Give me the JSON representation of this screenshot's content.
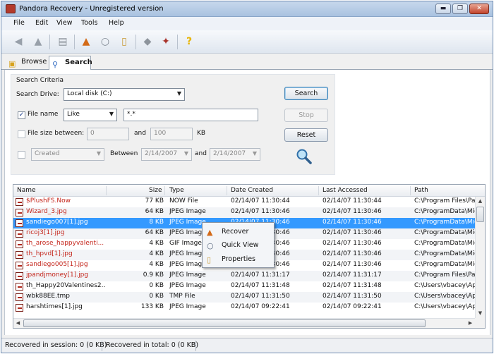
{
  "window": {
    "title": "Pandora Recovery - Unregistered version"
  },
  "menu": [
    "File",
    "Edit",
    "View",
    "Tools",
    "Help"
  ],
  "toolbar_icons": [
    "back-arrow-icon",
    "forward-arrow-icon",
    "drive-icon",
    "recover-icon",
    "quick-view-icon",
    "properties-icon",
    "eraser-icon",
    "wand-icon",
    "help-icon"
  ],
  "tabs": [
    {
      "label": "Browse",
      "icon": "folder-icon",
      "active": false
    },
    {
      "label": "Search",
      "icon": "magnifier-icon",
      "active": true
    }
  ],
  "criteria": {
    "legend": "Search Criteria",
    "drive_label": "Search Drive:",
    "drive_value": "Local disk (C:)",
    "filename_label": "File name",
    "filename_checked": true,
    "filename_mode": "Like",
    "filename_pattern": "*.*",
    "filesize_label": "File size between:",
    "filesize_min": "0",
    "filesize_and": "and",
    "filesize_max": "100",
    "filesize_unit": "KB",
    "date_type": "Created",
    "date_between": "Between",
    "date_from": "2/14/2007",
    "date_and": "and",
    "date_to": "2/14/2007"
  },
  "buttons": {
    "search": "Search",
    "stop": "Stop",
    "reset": "Reset"
  },
  "columns": {
    "name": "Name",
    "size": "Size",
    "type": "Type",
    "created": "Date Created",
    "accessed": "Last Accessed",
    "path": "Path"
  },
  "rows": [
    {
      "name": "$PlushFS.Now",
      "size": "77 KB",
      "type": "NOW File",
      "created": "02/14/07 11:30:44",
      "accessed": "02/14/07 11:30:44",
      "path": "C:\\Program Files\\Par",
      "red": true
    },
    {
      "name": "Wizard_3.jpg",
      "size": "64 KB",
      "type": "JPEG Image",
      "created": "02/14/07 11:30:46",
      "accessed": "02/14/07 11:30:46",
      "path": "C:\\ProgramData\\Mic",
      "red": true
    },
    {
      "name": "sandiego007[1].jpg",
      "size": "8 KB",
      "type": "JPEG Image",
      "created": "02/14/07 11:30:46",
      "accessed": "02/14/07 11:30:46",
      "path": "C:\\ProgramData\\Mic",
      "red": true,
      "selected": true
    },
    {
      "name": "ricoj3[1].jpg",
      "size": "64 KB",
      "type": "JPEG Image",
      "created": "02/14/07 11:30:46",
      "accessed": "02/14/07 11:30:46",
      "path": "C:\\ProgramData\\Mic",
      "red": true
    },
    {
      "name": "th_arose_happyvalenti...",
      "size": "4 KB",
      "type": "GIF Image",
      "created": "02/14/07 11:30:46",
      "accessed": "02/14/07 11:30:46",
      "path": "C:\\ProgramData\\Mic",
      "red": true
    },
    {
      "name": "th_hpvd[1].jpg",
      "size": "4 KB",
      "type": "JPEG Image",
      "created": "02/14/07 11:30:46",
      "accessed": "02/14/07 11:30:46",
      "path": "C:\\ProgramData\\Mic",
      "red": true
    },
    {
      "name": "sandiego005[1].jpg",
      "size": "4 KB",
      "type": "JPEG Image",
      "created": "02/14/07 11:30:46",
      "accessed": "02/14/07 11:30:46",
      "path": "C:\\ProgramData\\Mic",
      "red": true
    },
    {
      "name": "jpandjmoney[1].jpg",
      "size": "0.9 KB",
      "type": "JPEG Image",
      "created": "02/14/07 11:31:17",
      "accessed": "02/14/07 11:31:17",
      "path": "C:\\Program Files\\Par",
      "red": true
    },
    {
      "name": "th_Happy20Valentines2...",
      "size": "0 KB",
      "type": "JPEG Image",
      "created": "02/14/07 11:31:48",
      "accessed": "02/14/07 11:31:48",
      "path": "C:\\Users\\vbacey\\Ap",
      "red": false
    },
    {
      "name": "wbk88EE.tmp",
      "size": "0 KB",
      "type": "TMP File",
      "created": "02/14/07 11:31:50",
      "accessed": "02/14/07 11:31:50",
      "path": "C:\\Users\\vbacey\\Ap",
      "red": false
    },
    {
      "name": "harshtimes[1].jpg",
      "size": "133 KB",
      "type": "JPEG Image",
      "created": "02/14/07 09:22:41",
      "accessed": "02/14/07 09:22:41",
      "path": "C:\\Users\\vbacey\\Ap",
      "red": false
    }
  ],
  "context_menu": [
    {
      "label": "Recover",
      "icon": "recover-icon"
    },
    {
      "label": "Quick View",
      "icon": "quick-view-icon"
    },
    {
      "label": "Properties",
      "icon": "properties-icon"
    }
  ],
  "status": {
    "session": "Recovered in session: 0 (0 KB)",
    "total": "Recovered in total: 0 (0 KB)"
  }
}
